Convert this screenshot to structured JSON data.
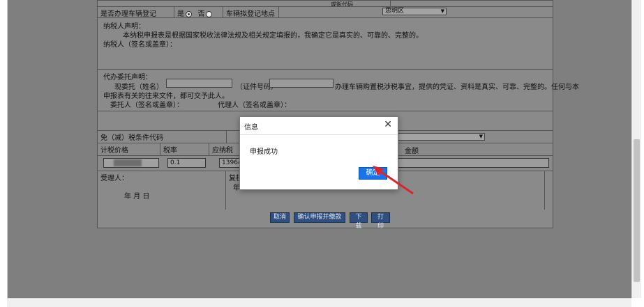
{
  "form": {
    "top_partial_label": "或街代码",
    "vehicle_reg_question": "是否办理车辆登记",
    "opt_yes": "是",
    "opt_no": "否",
    "reg_location_label": "车辆拟登记地点",
    "reg_location_value": "思明区",
    "taxpayer_decl_title": "纳税人声明：",
    "taxpayer_decl_text": "本纳税申报表是根据国家税收法律法规及相关规定填报的，我确定它是真实的、可靠的、完整的。",
    "taxpayer_sign": "纳税人（签名或盖章）：",
    "agent_decl_title": "代办委托声明：",
    "agent_line_prefix": "现委托（姓名）",
    "agent_id_label": "（证件号码）",
    "agent_line_suffix": "办理车辆购置税涉税事宜，提供的凭证、资料是真实、可靠、完整的。任何与本",
    "agent_line2": "申报表有关的往来文件，都可交予此人。",
    "principal_sign": "委托人（签名或盖章）：",
    "agent_sign": "代理人（签名或盖章）：",
    "exempt_code_label": "免（减）税条件代码",
    "col_price": "计税价格",
    "col_rate": "税率",
    "col_tax": "应纳税",
    "col_amount": "金额",
    "rate_value": "0.1",
    "tax_value": "13964",
    "receiver_label": "受理人：",
    "date_label": "年  月  日",
    "reviewer_label": "复核人",
    "reviewer_year": "年"
  },
  "buttons": {
    "cancel": "取消",
    "confirm_pay": "确认申报并缴款",
    "download": "下载",
    "print": "打印"
  },
  "dialog": {
    "title": "信息",
    "message": "申报成功",
    "ok": "确定"
  },
  "colors": {
    "overlay": "#7f7f7f",
    "ok_button": "#1a73e8",
    "arrow": "#d9262c"
  }
}
